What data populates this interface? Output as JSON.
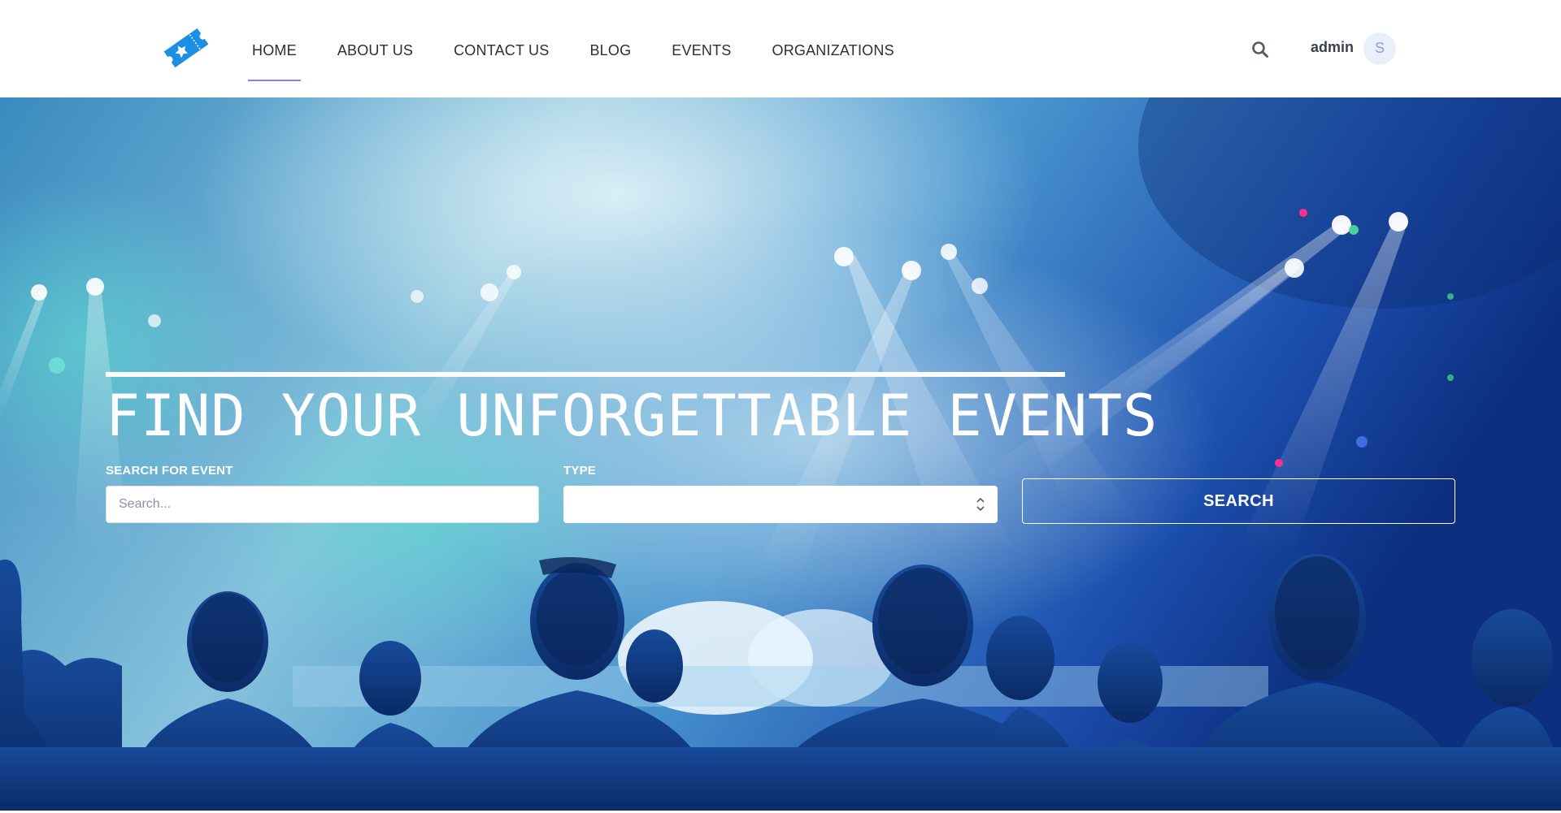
{
  "header": {
    "logo_icon": "ticket-star-icon",
    "nav": [
      {
        "label": "HOME",
        "active": true
      },
      {
        "label": "ABOUT US"
      },
      {
        "label": "CONTACT US"
      },
      {
        "label": "BLOG"
      },
      {
        "label": "EVENTS"
      },
      {
        "label": "ORGANIZATIONS"
      }
    ],
    "search_icon": "search-icon",
    "user_name": "admin",
    "avatar_initial": "S"
  },
  "hero": {
    "background": "concert-crowd-stage-lights-photo",
    "title": "FIND YOUR UNFORGETTABLE EVENTS",
    "search_label": "SEARCH FOR EVENT",
    "search_placeholder": "Search...",
    "type_label": "TYPE",
    "type_value": "",
    "search_button": "SEARCH"
  },
  "colors": {
    "brand_blue": "#1a8fe3",
    "nav_active_underline": "#7d86e6",
    "avatar_bg": "#eaf0fb",
    "hero_blue": "#1d4f9e"
  }
}
